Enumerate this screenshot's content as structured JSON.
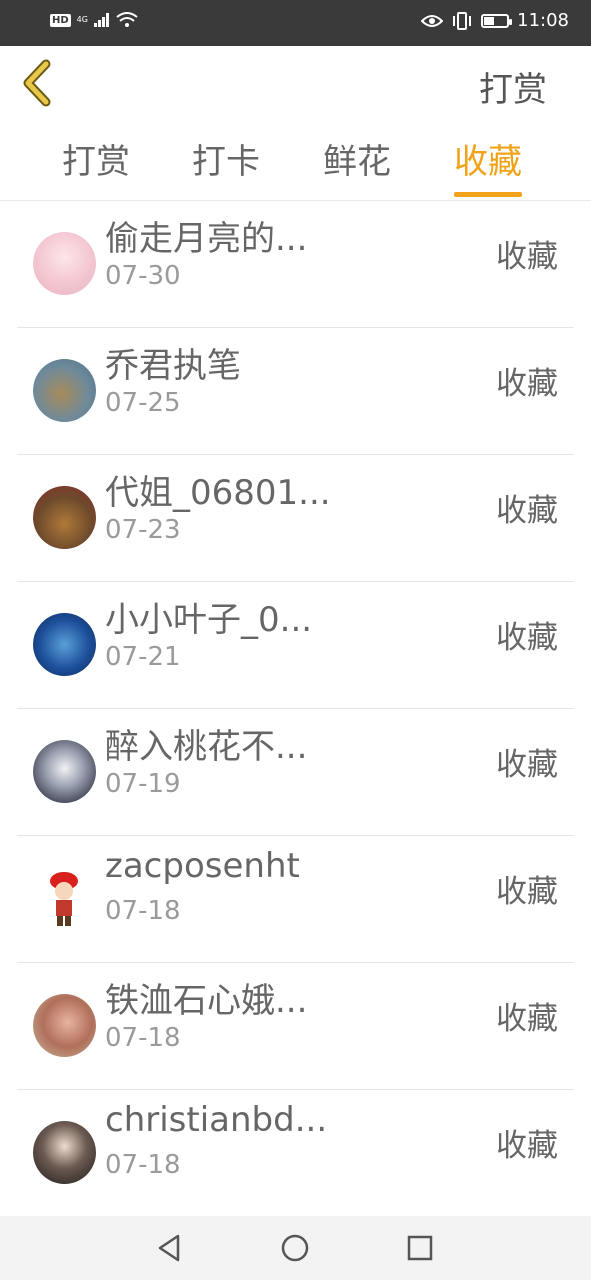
{
  "status_bar": {
    "hd": "HD",
    "network": "4G",
    "time": "11:08",
    "battery_level": 0.45
  },
  "header": {
    "title": "打赏"
  },
  "tabs": [
    {
      "label": "打赏",
      "active": false
    },
    {
      "label": "打卡",
      "active": false
    },
    {
      "label": "鲜花",
      "active": false
    },
    {
      "label": "收藏",
      "active": true
    }
  ],
  "list": [
    {
      "name": "偷走月亮的...",
      "date": "07-30",
      "action": "收藏"
    },
    {
      "name": "乔君执笔",
      "date": "07-25",
      "action": "收藏"
    },
    {
      "name": "代姐_06801...",
      "date": "07-23",
      "action": "收藏"
    },
    {
      "name": "小小叶子_0...",
      "date": "07-21",
      "action": "收藏"
    },
    {
      "name": "醉入桃花不...",
      "date": "07-19",
      "action": "收藏"
    },
    {
      "name": "zacposenht",
      "date": "07-18",
      "action": "收藏"
    },
    {
      "name": "铁洫石心娥...",
      "date": "07-18",
      "action": "收藏"
    },
    {
      "name": "christianbd...",
      "date": "07-18",
      "action": "收藏"
    }
  ],
  "colors": {
    "accent": "#f0a318",
    "back_icon": "#e8c84a",
    "text": "#666666",
    "muted": "#9a9a9a"
  }
}
